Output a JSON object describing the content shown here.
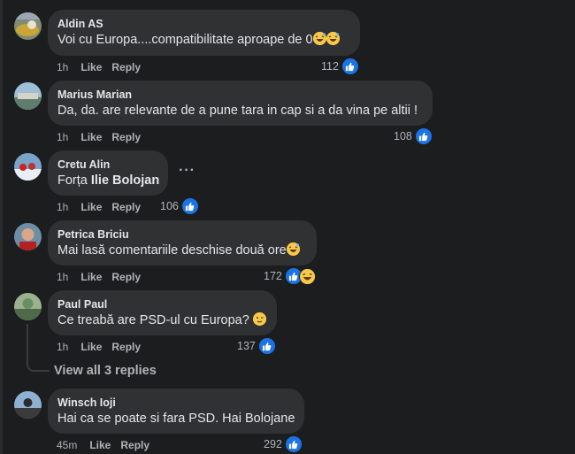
{
  "comments": [
    {
      "author": "Aldin AS",
      "text": "Voi cu Europa....compatibilitate aproape de 0",
      "time": "1h",
      "like": "Like",
      "reply": "Reply",
      "count": "112",
      "reactions": [
        "like-icon"
      ],
      "trailing_emojis": [
        "grinning-sweat-emoji",
        "grinning-sweat-emoji"
      ]
    },
    {
      "author": "Marius Marian",
      "text": "Da, da. are relevante de a pune tara in cap si a da vina pe altii !",
      "time": "1h",
      "like": "Like",
      "reply": "Reply",
      "count": "108",
      "reactions": [
        "like-icon"
      ]
    },
    {
      "author": "Cretu Alin",
      "text_prefix": "Forța ",
      "text_bold": "Ilie Bolojan",
      "time": "1h",
      "like": "Like",
      "reply": "Reply",
      "count": "106",
      "reactions": [
        "like-icon"
      ],
      "more": "···"
    },
    {
      "author": "Petrica Briciu",
      "text": "Mai lasă comentariile deschise două ore",
      "time": "1h",
      "like": "Like",
      "reply": "Reply",
      "count": "172",
      "reactions": [
        "like-icon",
        "haha-icon"
      ],
      "trailing_emojis": [
        "grinning-sweat-emoji"
      ]
    },
    {
      "author": "Paul Paul",
      "text": "Ce treabă are PSD-ul cu Europa?",
      "time": "1h",
      "like": "Like",
      "reply": "Reply",
      "count": "137",
      "reactions": [
        "like-icon"
      ],
      "trailing_emojis": [
        "winking-face-emoji"
      ]
    },
    {
      "author": "Winsch Ioji",
      "text": "Hai ca se poate si fara PSD. Hai Bolojane",
      "time": "45m",
      "like": "Like",
      "reply": "Reply",
      "count": "292",
      "reactions": [
        "like-icon"
      ]
    }
  ],
  "view_replies": "View all 3 replies",
  "colors": {
    "background": "#1c1d1f",
    "bubble": "#303133",
    "like_blue": "#1b74e4",
    "muted": "#b0b3b8",
    "text": "#e4e6eb"
  }
}
